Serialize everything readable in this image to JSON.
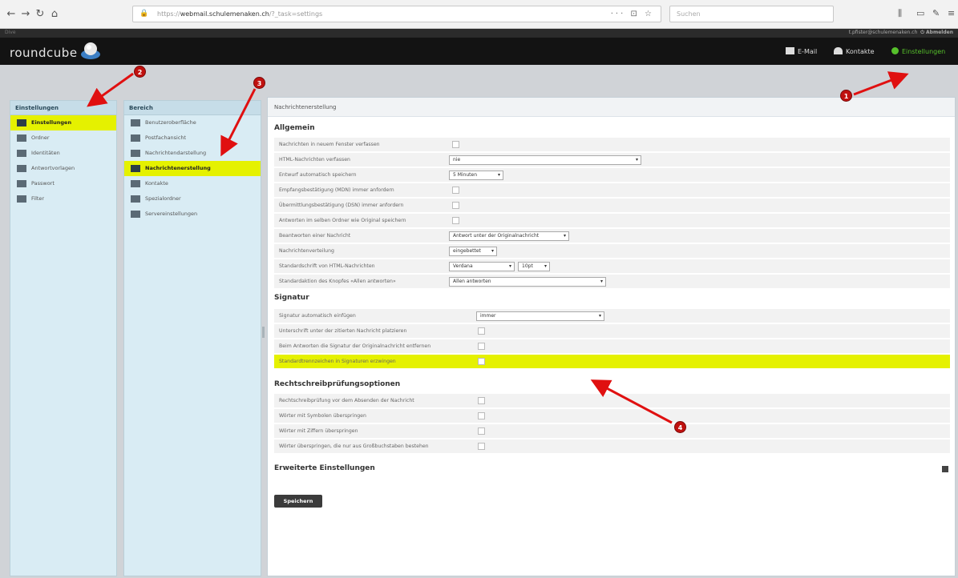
{
  "browser": {
    "url_prefix": "https://",
    "url_domain": "webmail.schulemenaken.ch",
    "url_suffix": "/?_task=settings",
    "search_placeholder": "Suchen",
    "page_actions": "··· ⊡ ☆"
  },
  "topline": {
    "left": "Dive",
    "user": "t.pfister@schulemenaken.ch",
    "logout": "⏻ Abmelden"
  },
  "app": {
    "logo": "roundcube",
    "tasks": [
      {
        "label": "E-Mail",
        "icon": "mail-icon"
      },
      {
        "label": "Kontakte",
        "icon": "contacts-icon"
      },
      {
        "label": "Einstellungen",
        "icon": "settings-icon"
      }
    ]
  },
  "settings_panel": {
    "title": "Einstellungen",
    "items": [
      {
        "label": "Einstellungen",
        "icon": "preferences-icon",
        "selected": true
      },
      {
        "label": "Ordner",
        "icon": "folder-icon",
        "selected": false
      },
      {
        "label": "Identitäten",
        "icon": "identity-icon",
        "selected": false
      },
      {
        "label": "Antwortvorlagen",
        "icon": "responses-icon",
        "selected": false
      },
      {
        "label": "Passwort",
        "icon": "password-icon",
        "selected": false
      },
      {
        "label": "Filter",
        "icon": "filter-icon",
        "selected": false
      }
    ]
  },
  "section_panel": {
    "title": "Bereich",
    "items": [
      {
        "label": "Benutzeroberfläche",
        "icon": "monitor-icon",
        "selected": false
      },
      {
        "label": "Postfachansicht",
        "icon": "mailbox-icon",
        "selected": false
      },
      {
        "label": "Nachrichtendarstellung",
        "icon": "message-view-icon",
        "selected": false
      },
      {
        "label": "Nachrichtenerstellung",
        "icon": "compose-icon",
        "selected": true
      },
      {
        "label": "Kontakte",
        "icon": "addressbook-icon",
        "selected": false
      },
      {
        "label": "Spezialordner",
        "icon": "special-folder-icon",
        "selected": false
      },
      {
        "label": "Servereinstellungen",
        "icon": "server-icon",
        "selected": false
      }
    ]
  },
  "content": {
    "header": "Nachrichtenerstellung",
    "sections": {
      "general": "Allgemein",
      "signature": "Signatur",
      "spellcheck": "Rechtschreibprüfungsoptionen",
      "advanced": "Erweiterte Einstellungen"
    },
    "general_rows": [
      {
        "label": "Nachrichten in neuem Fenster verfassen",
        "type": "checkbox"
      },
      {
        "label": "HTML-Nachrichten verfassen",
        "type": "select",
        "value": "nie"
      },
      {
        "label": "Entwurf automatisch speichern",
        "type": "select",
        "value": "5 Minuten"
      },
      {
        "label": "Empfangsbestätigung (MDN) immer anfordern",
        "type": "checkbox"
      },
      {
        "label": "Übermittlungsbestätigung (DSN) immer anfordern",
        "type": "checkbox"
      },
      {
        "label": "Antworten im selben Ordner wie Original speichern",
        "type": "checkbox"
      },
      {
        "label": "Beantworten einer Nachricht",
        "type": "select",
        "value": "Antwort unter der Originalnachricht"
      },
      {
        "label": "Nachrichtenverteilung",
        "type": "select",
        "value": "eingebettet"
      },
      {
        "label": "Standardschrift von HTML-Nachrichten",
        "type": "select2",
        "value": "Verdana",
        "value2": "10pt"
      },
      {
        "label": "Standardaktion des Knopfes «Allen antworten»",
        "type": "select",
        "value": "Allen antworten"
      }
    ],
    "signature_rows": [
      {
        "label": "Signatur automatisch einfügen",
        "type": "select",
        "value": "immer",
        "highlight": false
      },
      {
        "label": "Unterschrift unter der zitierten Nachricht platzieren",
        "type": "checkbox",
        "highlight": false
      },
      {
        "label": "Beim Antworten die Signatur der Originalnachricht entfernen",
        "type": "checkbox",
        "highlight": false
      },
      {
        "label": "Standardtrennzeichen in Signaturen erzwingen",
        "type": "checkbox",
        "highlight": true
      }
    ],
    "spell_rows": [
      {
        "label": "Rechtschreibprüfung vor dem Absenden der Nachricht",
        "type": "checkbox"
      },
      {
        "label": "Wörter mit Symbolen überspringen",
        "type": "checkbox"
      },
      {
        "label": "Wörter mit Ziffern überspringen",
        "type": "checkbox"
      },
      {
        "label": "Wörter überspringen, die nur aus Großbuchstaben bestehen",
        "type": "checkbox"
      }
    ],
    "save_label": "Speichern"
  },
  "annotations": [
    "1",
    "2",
    "3",
    "4"
  ],
  "colors": {
    "highlight": "#e5f100",
    "badge": "#c0110f",
    "arrow": "#e01010",
    "header_bg": "#131313"
  }
}
